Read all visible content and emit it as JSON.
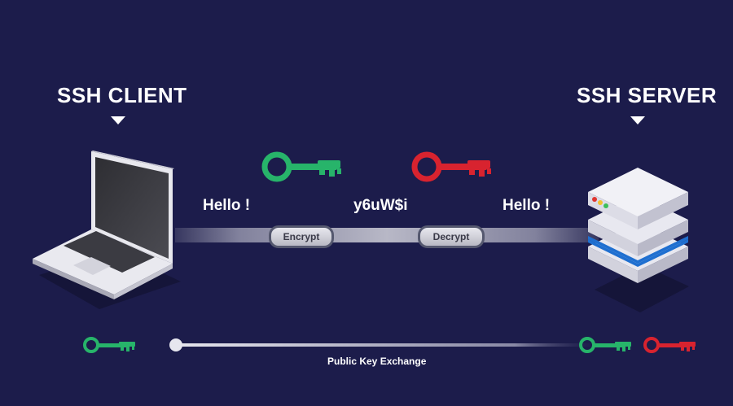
{
  "client": {
    "title": "SSH CLIENT"
  },
  "server": {
    "title": "SSH SERVER"
  },
  "messages": {
    "plain_left": "Hello !",
    "cipher": "y6uW$i",
    "plain_right": "Hello !"
  },
  "steps": {
    "encrypt_label": "Encrypt",
    "decrypt_label": "Decrypt"
  },
  "exchange": {
    "label": "Public Key Exchange"
  },
  "keys": {
    "public_color": "#27b46a",
    "private_color": "#d8232f"
  },
  "colors": {
    "background": "#1c1c4b",
    "text": "#ffffff"
  }
}
